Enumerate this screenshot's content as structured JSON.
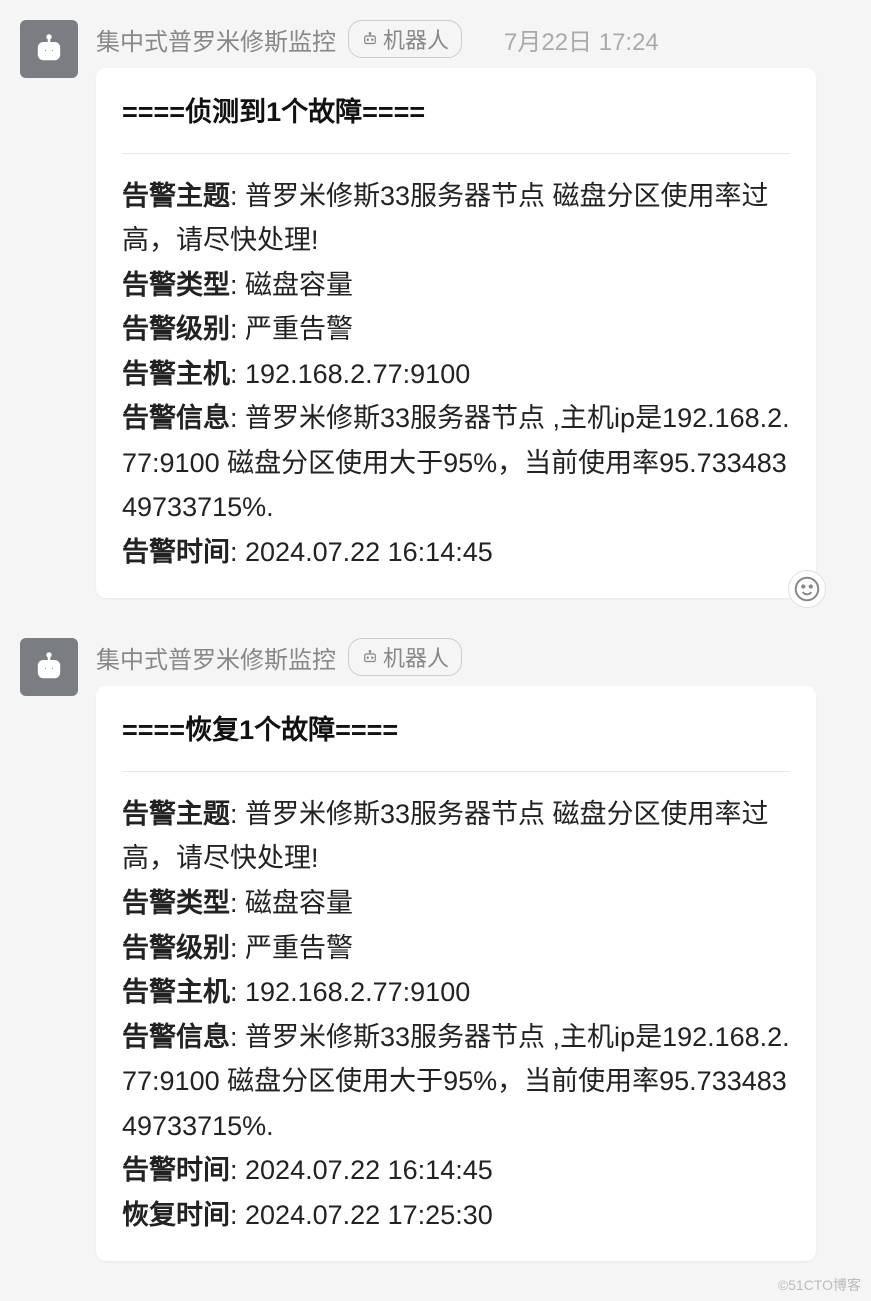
{
  "messages": [
    {
      "sender": "集中式普罗米修斯监控",
      "bot_label": "机器人",
      "timestamp": "7月22日 17:24",
      "title": "====侦测到1个故障====",
      "fields": [
        {
          "label": "告警主题",
          "value": "普罗米修斯33服务器节点 磁盘分区使用率过高，请尽快处理!"
        },
        {
          "label": "告警类型",
          "value": "磁盘容量"
        },
        {
          "label": "告警级别",
          "value": "严重告警"
        },
        {
          "label": "告警主机",
          "value": "192.168.2.77:9100"
        },
        {
          "label": "告警信息",
          "value": "普罗米修斯33服务器节点 ,主机ip是192.168.2.77:9100 磁盘分区使用大于95%，当前使用率95.73348349733715%."
        },
        {
          "label": "告警时间",
          "value": "2024.07.22 16:14:45"
        }
      ],
      "has_react": true
    },
    {
      "sender": "集中式普罗米修斯监控",
      "bot_label": "机器人",
      "timestamp": "",
      "title": "====恢复1个故障====",
      "fields": [
        {
          "label": "告警主题",
          "value": "普罗米修斯33服务器节点 磁盘分区使用率过高，请尽快处理!"
        },
        {
          "label": "告警类型",
          "value": "磁盘容量"
        },
        {
          "label": "告警级别",
          "value": "严重告警"
        },
        {
          "label": "告警主机",
          "value": "192.168.2.77:9100"
        },
        {
          "label": "告警信息",
          "value": "普罗米修斯33服务器节点 ,主机ip是192.168.2.77:9100 磁盘分区使用大于95%，当前使用率95.73348349733715%."
        },
        {
          "label": "告警时间",
          "value": "2024.07.22 16:14:45"
        },
        {
          "label": "恢复时间",
          "value": "2024.07.22 17:25:30"
        }
      ],
      "has_react": false
    }
  ],
  "watermark": "©51CTO博客"
}
